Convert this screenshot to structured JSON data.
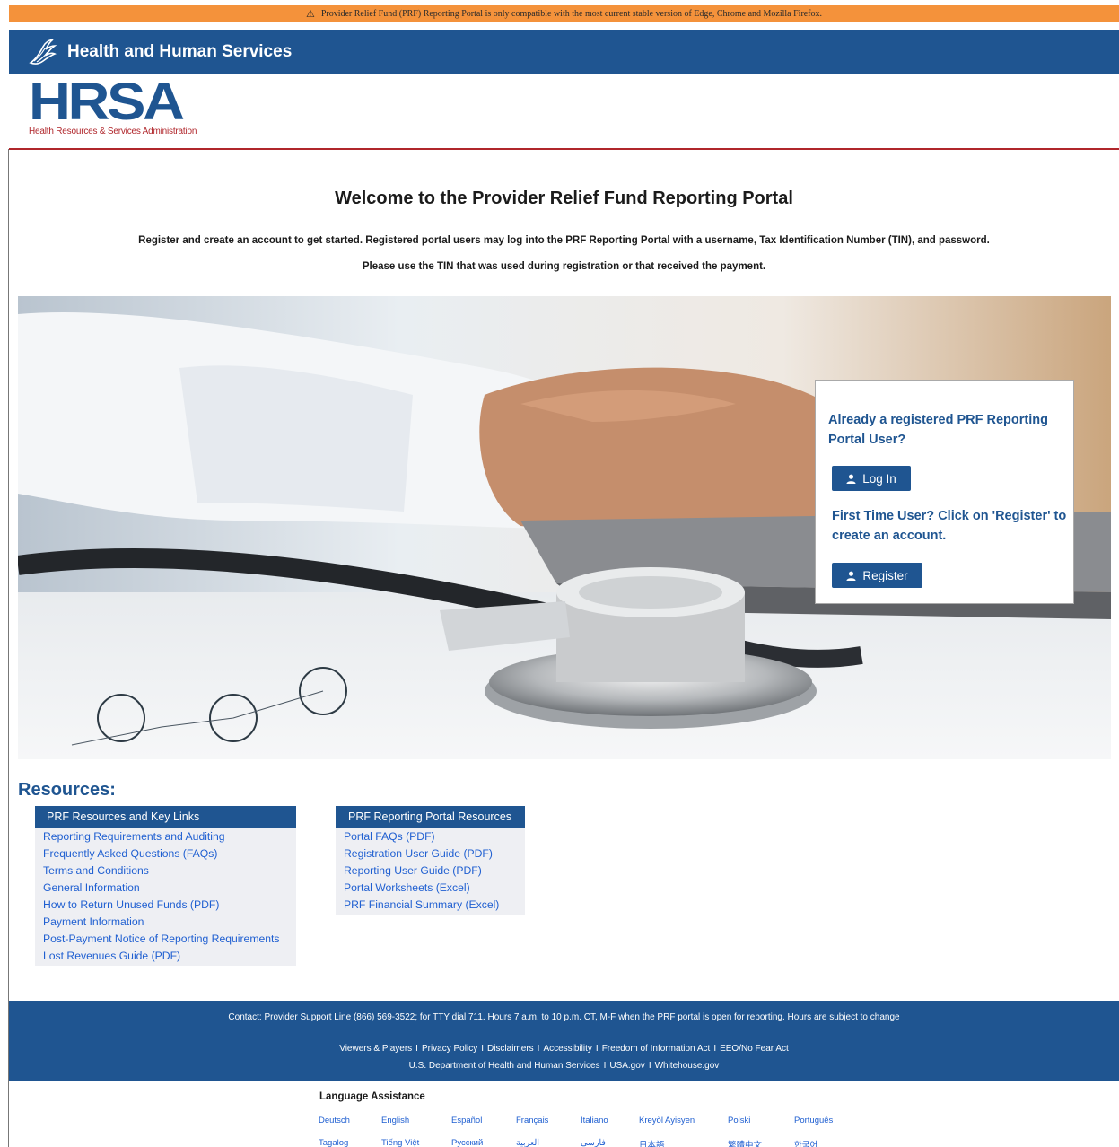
{
  "alert": {
    "text": "Provider Relief Fund (PRF) Reporting Portal is only compatible with the most current stable version of Edge, Chrome and Mozilla Firefox."
  },
  "header": {
    "agency": "Health and Human Services"
  },
  "logo": {
    "letters": "HRSA",
    "subtitle": "Health Resources & Services Administration"
  },
  "main": {
    "title": "Welcome to the Provider Relief Fund Reporting Portal",
    "intro_line1": "Register and create an account to get started. Registered portal users may log into the PRF Reporting Portal with a username, Tax Identification Number (TIN), and password.",
    "intro_line2": "Please use the TIN that was used during registration or that received the payment."
  },
  "login_card": {
    "registered_prompt": "Already a registered PRF Reporting Portal User?",
    "login_label": "Log In",
    "first_time_prompt": "First Time User? Click on 'Register' to create an account.",
    "register_label": "Register"
  },
  "resources": {
    "title": "Resources:",
    "left": {
      "header": "PRF Resources and Key Links",
      "links": [
        "Reporting Requirements and Auditing",
        "Frequently Asked Questions (FAQs)",
        "Terms and Conditions",
        "General Information",
        "How to Return Unused Funds (PDF)",
        "Payment Information",
        "Post-Payment Notice of Reporting Requirements",
        "Lost Revenues Guide (PDF)"
      ]
    },
    "right": {
      "header": "PRF Reporting Portal Resources",
      "links": [
        "Portal FAQs (PDF)",
        "Registration User Guide (PDF)",
        "Reporting User Guide (PDF)",
        "Portal Worksheets (Excel)",
        "PRF Financial Summary (Excel)"
      ]
    }
  },
  "footer": {
    "contact": "Contact: Provider Support Line (866) 569-3522; for TTY dial 711. Hours 7 a.m. to 10 p.m. CT, M-F when the PRF portal is open for reporting. Hours are subject to change",
    "separator": "I",
    "links_row1": [
      "Viewers & Players",
      "Privacy Policy",
      "Disclaimers",
      "Accessibility",
      "Freedom of Information Act",
      "EEO/No Fear Act"
    ],
    "links_row2": [
      "U.S. Department of Health and Human Services",
      "USA.gov",
      "Whitehouse.gov"
    ]
  },
  "language": {
    "title": "Language Assistance",
    "row1": [
      "Deutsch",
      "English",
      "Español",
      "Français",
      "Italiano",
      "Kreyòl Ayisyen",
      "Polski",
      "Português"
    ],
    "row2": [
      "Tagalog",
      "Tiếng Việt",
      "Русский",
      "العربية",
      "فارسی",
      "日本語",
      "繁體中文",
      "한국어"
    ]
  },
  "colors": {
    "brand_blue": "#1f5591",
    "alert_orange": "#f4923b",
    "hrsa_red": "#b0262b",
    "link_blue": "#1f5fd1"
  },
  "icons": {
    "alert": "warning-triangle-icon",
    "agency": "hhs-eagle-icon",
    "buttons": "person-icon"
  }
}
